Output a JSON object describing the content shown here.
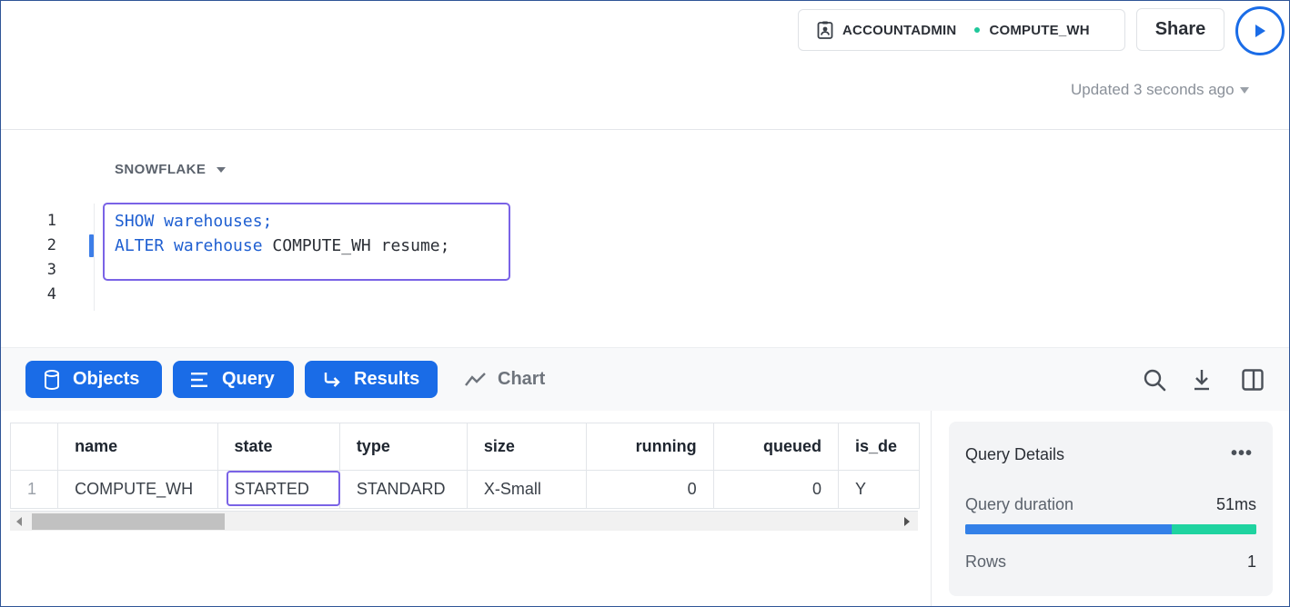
{
  "header": {
    "role": "ACCOUNTADMIN",
    "warehouse": "COMPUTE_WH",
    "share_label": "Share",
    "updated_text": "Updated 3 seconds ago"
  },
  "editor": {
    "database": "SNOWFLAKE",
    "line_numbers": [
      "1",
      "2",
      "3",
      "4"
    ],
    "lines": [
      {
        "kw": "SHOW warehouses;",
        "rest": ""
      },
      {
        "kw": "ALTER warehouse",
        "rest": " COMPUTE_WH resume;"
      },
      {
        "kw": "",
        "rest": ""
      },
      {
        "kw": "",
        "rest": ""
      }
    ]
  },
  "toolbar": {
    "objects": "Objects",
    "query": "Query",
    "results": "Results",
    "chart": "Chart"
  },
  "results": {
    "columns": [
      "",
      "name",
      "state",
      "type",
      "size",
      "running",
      "queued",
      "is_de"
    ],
    "rows": [
      [
        "1",
        "COMPUTE_WH",
        "STARTED",
        "STANDARD",
        "X-Small",
        "0",
        "0",
        "Y"
      ]
    ]
  },
  "details": {
    "title": "Query Details",
    "more": "•••",
    "duration_label": "Query duration",
    "duration_value": "51ms",
    "duration_split": 0.71,
    "rows_label": "Rows",
    "rows_value": "1"
  },
  "colors": {
    "accent": "#1a6ce7",
    "highlight": "#7a63e6",
    "success": "#1fd3a0"
  }
}
